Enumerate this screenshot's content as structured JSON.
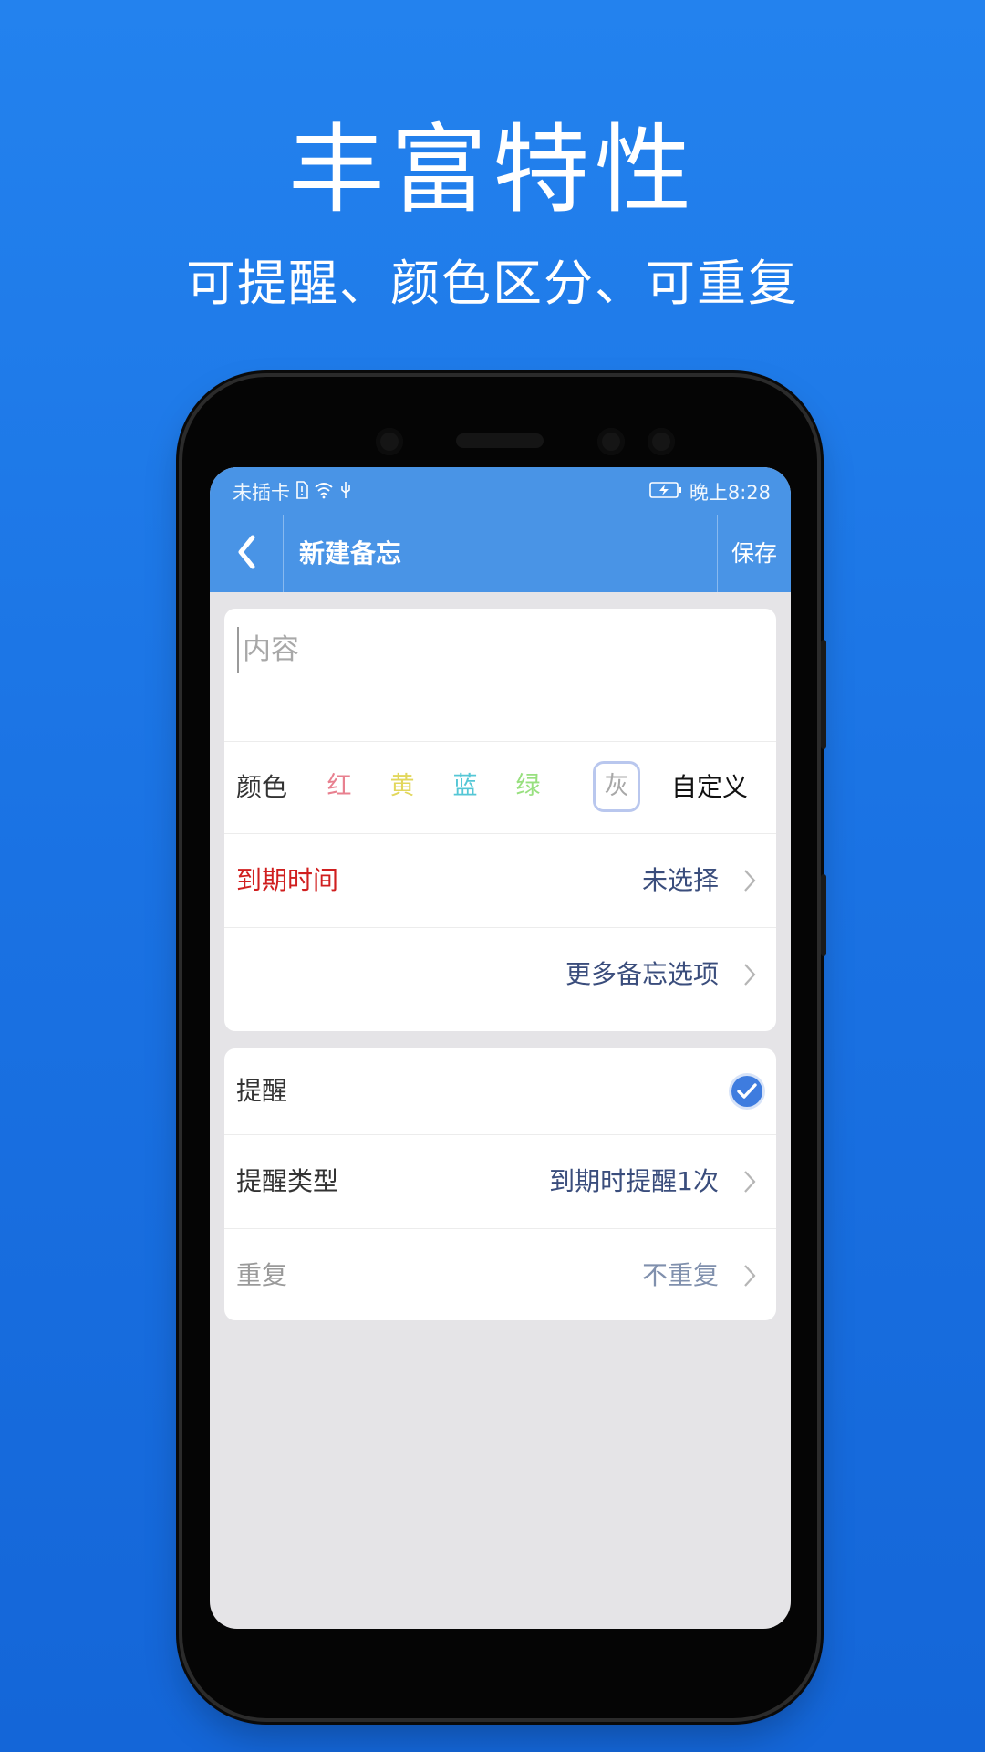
{
  "promo": {
    "title": "丰富特性",
    "subtitle": "可提醒、颜色区分、可重复"
  },
  "status_bar": {
    "carrier": "未插卡",
    "time": "晚上8:28",
    "icons": [
      "sim-icon",
      "wifi-icon",
      "usb-icon",
      "battery-charging-icon"
    ]
  },
  "toolbar": {
    "back_icon": "back-chevron-icon",
    "title": "新建备忘",
    "save_label": "保存"
  },
  "form": {
    "content_placeholder": "内容",
    "color": {
      "label": "颜色",
      "options": [
        {
          "label": "红",
          "color": "#e8808f"
        },
        {
          "label": "黄",
          "color": "#e2d75c"
        },
        {
          "label": "蓝",
          "color": "#55c7d6"
        },
        {
          "label": "绿",
          "color": "#98e07f"
        },
        {
          "label": "灰",
          "color": "#a8a8a8"
        }
      ],
      "selected": "灰",
      "custom_label": "自定义"
    },
    "due_time": {
      "label": "到期时间",
      "value": "未选择",
      "label_color": "#d01f1f"
    },
    "more_options": {
      "label": "更多备忘选项"
    },
    "reminder": {
      "label": "提醒",
      "checked": true
    },
    "reminder_type": {
      "label": "提醒类型",
      "value": "到期时提醒1次"
    },
    "repeat": {
      "label": "重复",
      "value": "不重复"
    }
  },
  "colors": {
    "background": "#1a72e3",
    "app_bar": "#4994e6",
    "screen_bg": "#e5e4e7",
    "value_text": "#3a4d7c",
    "check_blue": "#3e7cdf"
  }
}
